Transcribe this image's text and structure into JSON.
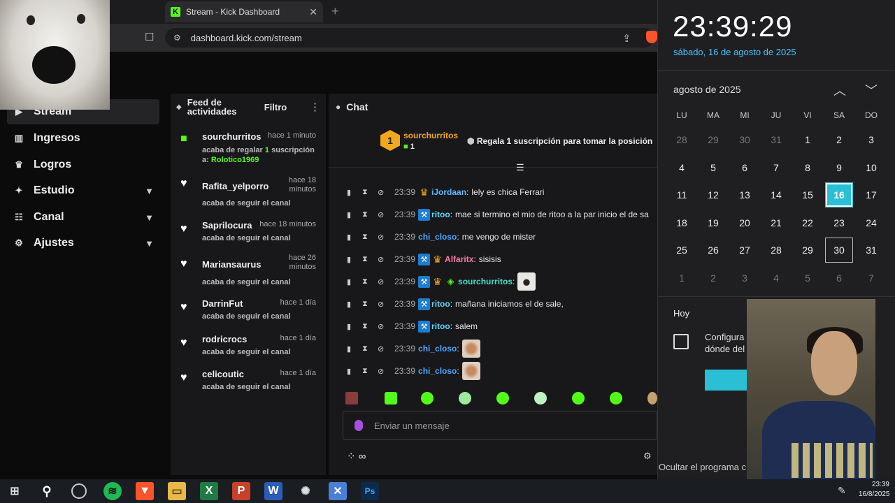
{
  "browser": {
    "tab_title": "Stream - Kick Dashboard",
    "tab_favicon": "K",
    "new_tab": "+",
    "close": "✕",
    "url": "dashboard.kick.com/stream"
  },
  "sidebar": {
    "items": [
      {
        "label": "Stream",
        "icon": "stream-icon"
      },
      {
        "label": "Ingresos",
        "icon": "chart-icon"
      },
      {
        "label": "Logros",
        "icon": "trophy-icon"
      },
      {
        "label": "Estudio",
        "icon": "studio-icon"
      },
      {
        "label": "Canal",
        "icon": "channel-icon"
      },
      {
        "label": "Ajustes",
        "icon": "gear-icon"
      }
    ]
  },
  "feed": {
    "title": "Feed de actividades",
    "filter": "Filtro",
    "items": [
      {
        "name": "sourchurritos",
        "time": "hace 1 minuto",
        "desc_pre": "acaba de regalar ",
        "desc_hl": "1",
        "desc_mid": " suscripción a: ",
        "desc_hl2": "Rolotico1969",
        "type": "gift"
      },
      {
        "name": "Rafita_yelporro",
        "time": "hace 18 minutos",
        "desc": "acaba de seguir el canal",
        "type": "follow"
      },
      {
        "name": "Saprilocura",
        "time": "hace 18 minutos",
        "desc": "acaba de seguir el canal",
        "type": "follow"
      },
      {
        "name": "Mariansaurus",
        "time": "hace 26 minutos",
        "desc": "acaba de seguir el canal",
        "type": "follow"
      },
      {
        "name": "DarrinFut",
        "time": "hace 1 día",
        "desc": "acaba de seguir el canal",
        "type": "follow"
      },
      {
        "name": "rodricrocs",
        "time": "hace 1 día",
        "desc": "acaba de seguir el canal",
        "type": "follow"
      },
      {
        "name": "celicoutic",
        "time": "hace 1 día",
        "desc": "acaba de seguir el canal",
        "type": "follow"
      }
    ]
  },
  "chat": {
    "title": "Chat",
    "pinned": {
      "rank": "1",
      "name": "sourchurritos",
      "count": "1",
      "message": "Regala 1 suscripción para tomar la posición"
    },
    "messages": [
      {
        "time": "23:39",
        "badges": [
          "crown"
        ],
        "user": "iJordaan",
        "color": "#5fb8ff",
        "text": "lely es chica Ferrari"
      },
      {
        "time": "23:39",
        "badges": [
          "mod"
        ],
        "user": "ritoo",
        "color": "#5fd6ff",
        "text": "mae si termino el mio de ritoo a la par inicio el de sa"
      },
      {
        "time": "23:39",
        "badges": [],
        "user": "chi_closo",
        "color": "#4ea6ff",
        "text": "me vengo de mister"
      },
      {
        "time": "23:39",
        "badges": [
          "mod",
          "crown"
        ],
        "user": "Alfaritx",
        "color": "#ff7aa8",
        "text": "sisisis"
      },
      {
        "time": "23:39",
        "badges": [
          "mod",
          "crown",
          "vip"
        ],
        "user": "sourchurritos",
        "color": "#3ee0c8",
        "text": "",
        "emote": "dog"
      },
      {
        "time": "23:39",
        "badges": [
          "mod"
        ],
        "user": "ritoo",
        "color": "#5fd6ff",
        "text": "mañana iniciamos el de sale,"
      },
      {
        "time": "23:39",
        "badges": [
          "mod"
        ],
        "user": "ritoo",
        "color": "#5fd6ff",
        "text": "salem"
      },
      {
        "time": "23:39",
        "badges": [],
        "user": "chi_closo",
        "color": "#4ea6ff",
        "text": "",
        "emote": "pup"
      },
      {
        "time": "23:39",
        "badges": [],
        "user": "chi_closo",
        "color": "#4ea6ff",
        "text": "",
        "emote": "pup"
      }
    ],
    "input_placeholder": "Enviar un mensaje"
  },
  "calendar": {
    "clock": "23:39:29",
    "date_long": "sábado, 16 de agosto de 2025",
    "month": "agosto de 2025",
    "weekdays": [
      "LU",
      "MA",
      "MI",
      "JU",
      "VI",
      "SA",
      "DO"
    ],
    "weeks": [
      [
        "28",
        "29",
        "30",
        "31",
        "1",
        "2",
        "3"
      ],
      [
        "4",
        "5",
        "6",
        "7",
        "8",
        "9",
        "10"
      ],
      [
        "11",
        "12",
        "13",
        "14",
        "15",
        "16",
        "17"
      ],
      [
        "18",
        "19",
        "20",
        "21",
        "22",
        "23",
        "24"
      ],
      [
        "25",
        "26",
        "27",
        "28",
        "29",
        "30",
        "31"
      ],
      [
        "1",
        "2",
        "3",
        "4",
        "5",
        "6",
        "7"
      ]
    ],
    "today": "16",
    "hoy": "Hoy",
    "config_line1": "Configura",
    "config_line2": "dónde del",
    "hide_program": "Ocultar el programa c"
  },
  "taskbar": {
    "time": "23:39",
    "date": "16/8/2025"
  }
}
